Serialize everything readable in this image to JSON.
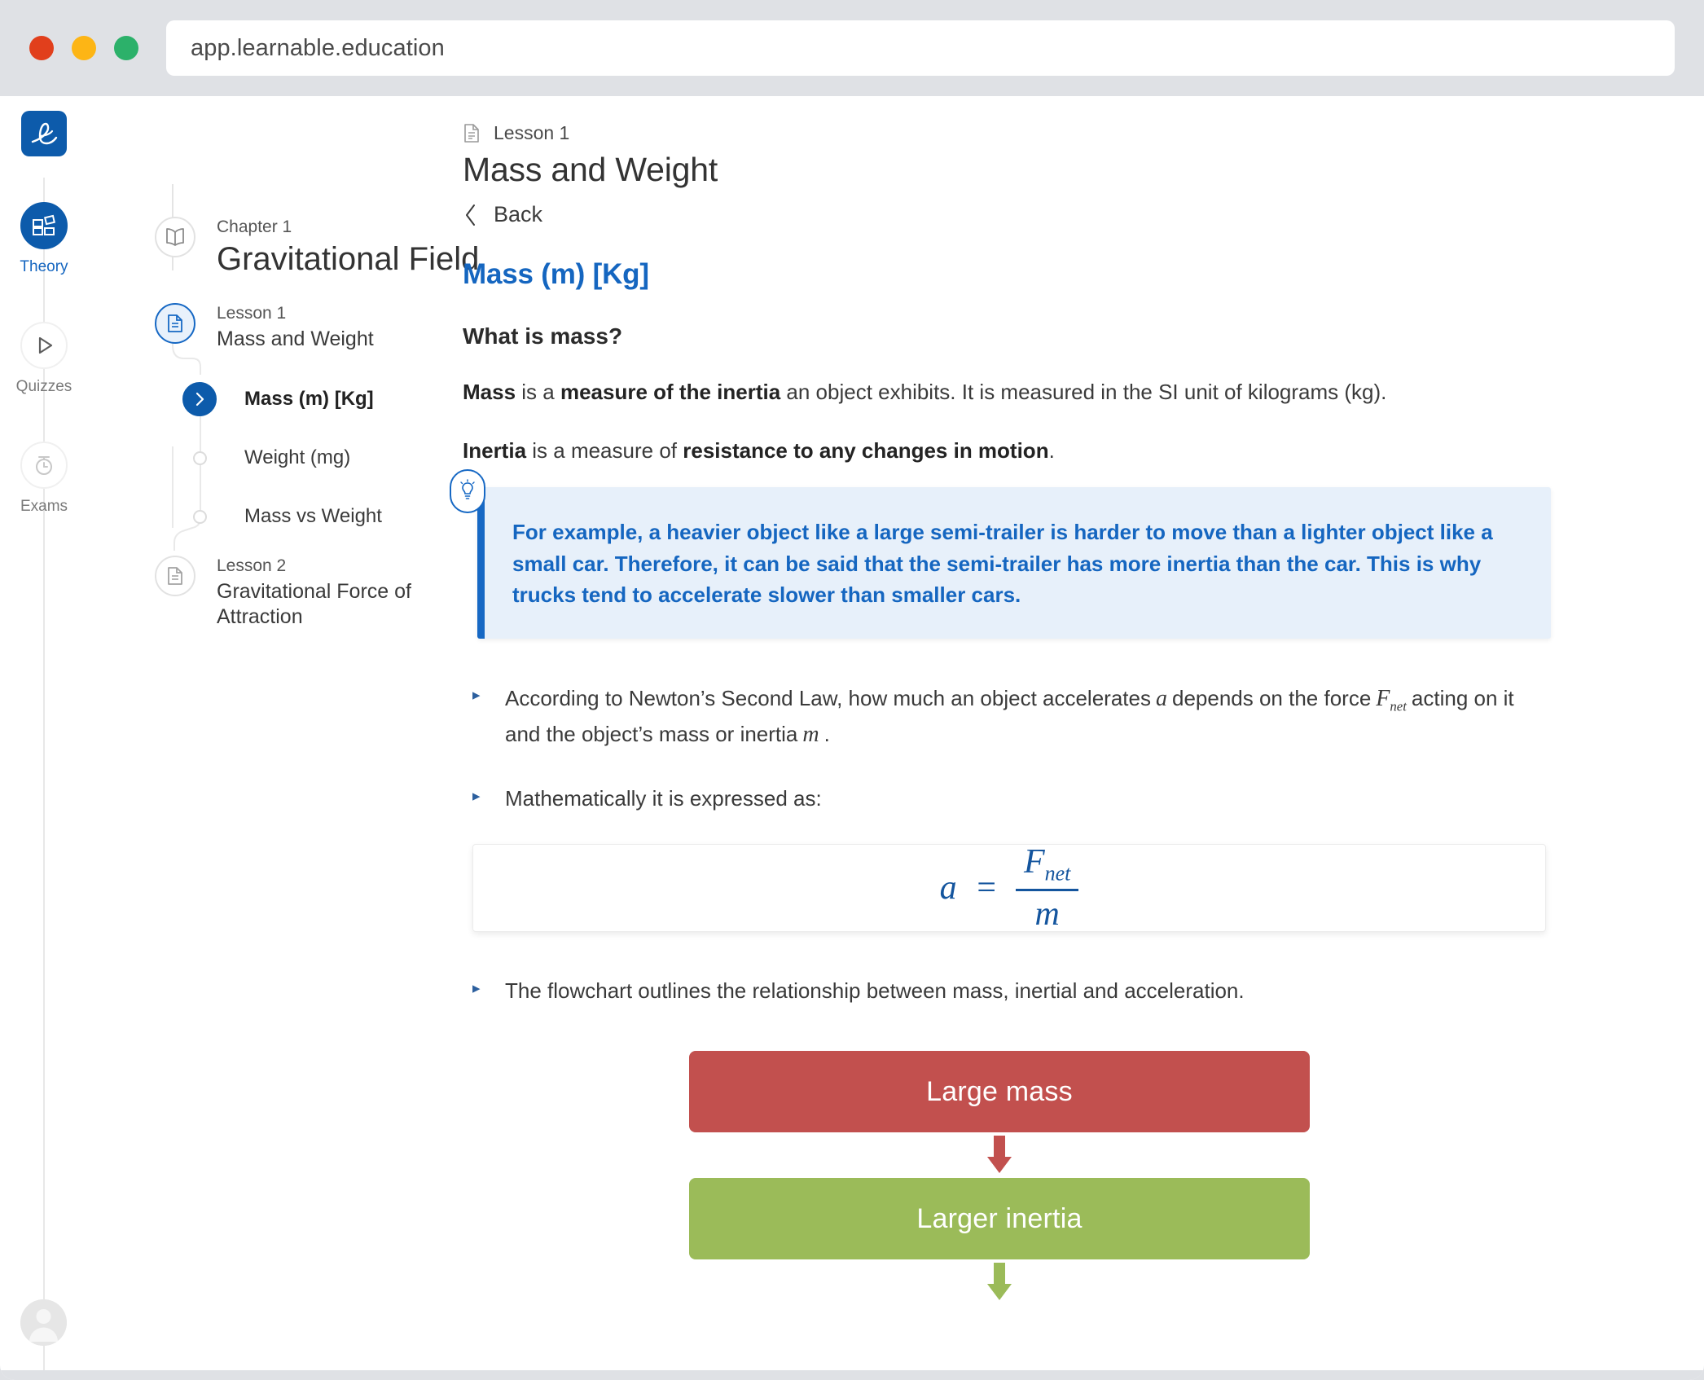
{
  "browser": {
    "url": "app.learnable.education",
    "traffic_lights": [
      "close-red",
      "minimize-yellow",
      "maximize-green"
    ]
  },
  "brand": {
    "logo_text": "le",
    "accent": "#0d5bab",
    "link_blue": "#1566c0"
  },
  "rail": {
    "items": [
      {
        "label": "Theory",
        "icon": "grid-blocks-icon",
        "active": true
      },
      {
        "label": "Quizzes",
        "icon": "play-triangle-icon",
        "active": false
      },
      {
        "label": "Exams",
        "icon": "stopwatch-icon",
        "active": false
      }
    ],
    "avatar": "user-avatar"
  },
  "toc": {
    "chapter_eyebrow": "Chapter 1",
    "chapter_title": "Gravitational Field",
    "lesson1_eyebrow": "Lesson 1",
    "lesson1_title": "Mass and Weight",
    "sub1": "Mass (m) [Kg]",
    "sub2": "Weight (mg)",
    "sub3": "Mass vs Weight",
    "lesson2_eyebrow": "Lesson 2",
    "lesson2_title": "Gravitational Force of Attraction"
  },
  "main": {
    "lesson_eyebrow": "Lesson 1",
    "lesson_title": "Mass and Weight",
    "back_label": "Back",
    "section_heading": "Mass (m) [Kg]",
    "question_heading": "What is mass?",
    "para1": {
      "b1": "Mass",
      "t1": " is a ",
      "b2": "measure of the inertia",
      "t2": " an object exhibits. It is measured in the SI unit of kilograms (kg)."
    },
    "para2": {
      "b1": "Inertia",
      "t1": " is a measure of ",
      "b2": "resistance to any changes in motion",
      "t2": "."
    },
    "callout": {
      "icon": "lightbulb-icon",
      "text": "For example, a heavier object like a large semi-trailer is harder to move than a lighter object like a small car. Therefore, it can be said that the semi-trailer has more inertia than the car. This is why trucks tend to accelerate slower than smaller cars."
    },
    "bullets": [
      {
        "pre": "According to Newton’s Second Law, how much an object accelerates",
        "sym1": "a",
        "mid": "depends on the force",
        "sym2": "F",
        "sym2sub": "net",
        "post": "acting on it and the object’s mass or inertia",
        "sym3": "m",
        "end": "."
      },
      {
        "pre": "Mathematically it is expressed as:"
      },
      {
        "pre": "The flowchart outlines the relationship between mass, inertial and acceleration."
      }
    ],
    "formula": {
      "lhs": "a",
      "eq": "=",
      "num": "F",
      "num_sub": "net",
      "den": "m"
    },
    "flowchart": {
      "nodes": [
        {
          "label": "Large mass",
          "color": "#c2504e"
        },
        {
          "label": "Larger inertia",
          "color": "#9bbb59"
        }
      ],
      "arrows": [
        {
          "color": "#c2504e"
        },
        {
          "color": "#9bbb59"
        }
      ]
    }
  }
}
